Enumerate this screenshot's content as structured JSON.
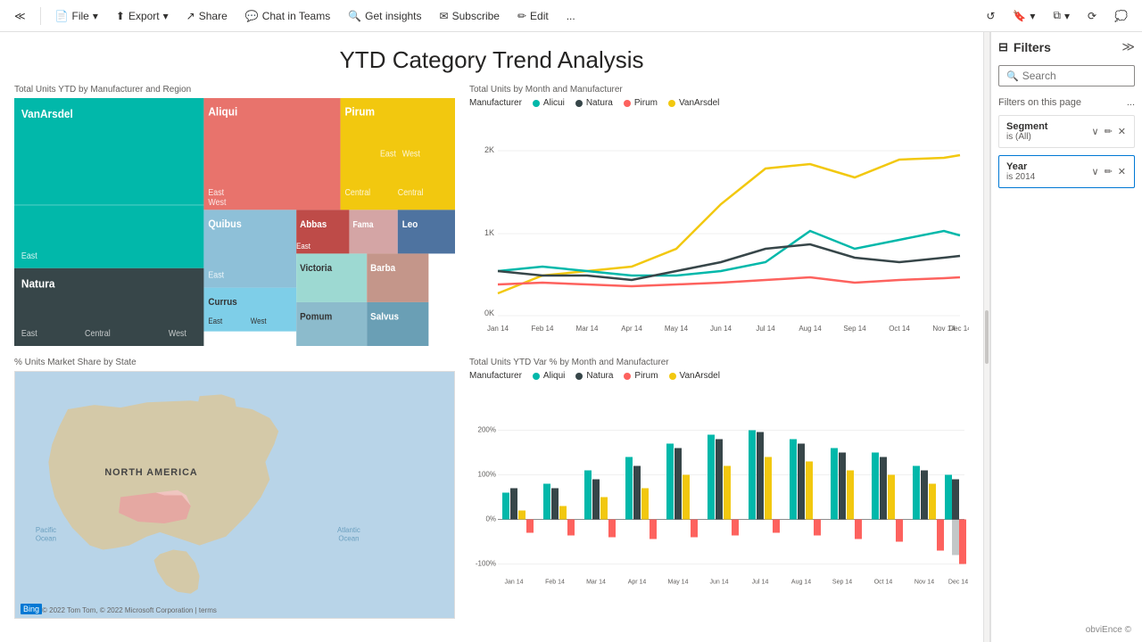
{
  "toolbar": {
    "items": [
      {
        "id": "nav-back",
        "label": "≪",
        "icon": "chevron-left"
      },
      {
        "id": "file",
        "label": "File",
        "has_arrow": true
      },
      {
        "id": "export",
        "label": "Export",
        "has_arrow": true
      },
      {
        "id": "share",
        "label": "Share"
      },
      {
        "id": "chat-teams",
        "label": "Chat in Teams"
      },
      {
        "id": "get-insights",
        "label": "Get insights"
      },
      {
        "id": "subscribe",
        "label": "Subscribe"
      },
      {
        "id": "edit",
        "label": "Edit"
      },
      {
        "id": "more",
        "label": "..."
      }
    ]
  },
  "page": {
    "title": "YTD Category Trend Analysis"
  },
  "charts": {
    "treemap": {
      "label": "Total Units YTD by Manufacturer and Region"
    },
    "line_chart": {
      "label": "Total Units by Month and Manufacturer",
      "legend": [
        {
          "name": "Alicui",
          "color": "#01B8AA"
        },
        {
          "name": "Natura",
          "color": "#374649"
        },
        {
          "name": "Pirum",
          "color": "#FD625E"
        },
        {
          "name": "VanArsdel",
          "color": "#F2C80F"
        }
      ],
      "y_labels": [
        "2K",
        "1K",
        "0K"
      ],
      "x_labels": [
        "Jan 14",
        "Feb 14",
        "Mar 14",
        "Apr 14",
        "May 14",
        "Jun 14",
        "Jul 14",
        "Aug 14",
        "Sep 14",
        "Oct 14",
        "Nov 14",
        "Dec 14"
      ]
    },
    "map": {
      "label": "% Units Market Share by State",
      "overlay_text": "NORTH AMERICA",
      "pacific": "Pacific\nOcean",
      "atlantic": "Atlantic\nOcean",
      "copyright": "© 2022 Tom Tom, © 2022 Microsoft Corporation  | terms"
    },
    "bar_chart": {
      "label": "Total Units YTD Var % by Month and Manufacturer",
      "legend": [
        {
          "name": "Aliqui",
          "color": "#01B8AA"
        },
        {
          "name": "Natura",
          "color": "#374649"
        },
        {
          "name": "Pirum",
          "color": "#FD625E"
        },
        {
          "name": "VanArsdel",
          "color": "#F2C80F"
        }
      ],
      "y_labels": [
        "200%",
        "100%",
        "0%",
        "-100%"
      ],
      "x_labels": [
        "Jan 14",
        "Feb 14",
        "Mar 14",
        "Apr 14",
        "May 14",
        "Jun 14",
        "Jul 14",
        "Aug 14",
        "Sep 14",
        "Oct 14",
        "Nov 14",
        "Dec 14"
      ]
    }
  },
  "filters": {
    "title": "Filters",
    "search_placeholder": "Search",
    "filters_on_page_label": "Filters on this page",
    "filters_on_page_more": "...",
    "items": [
      {
        "name": "Segment",
        "value": "is (All)"
      },
      {
        "name": "Year",
        "value": "is 2014"
      }
    ]
  },
  "watermark": "obviEnce ©"
}
